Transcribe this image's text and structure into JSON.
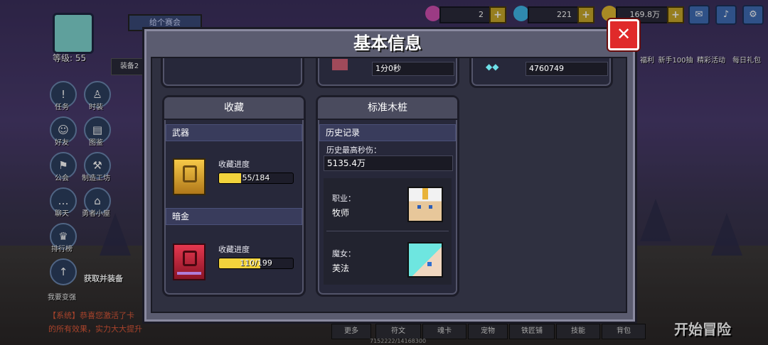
{
  "hud": {
    "level": "等级: 55",
    "name_placeholder": "给个赛会",
    "resources": [
      {
        "icon": "pink-gem-icon",
        "value": "2",
        "color": "#d14fb0"
      },
      {
        "icon": "blue-diamond-icon",
        "value": "221",
        "color": "#3fb7e8"
      },
      {
        "icon": "gold-coin-icon",
        "value": "169.8万",
        "color": "#e0b830"
      }
    ],
    "buttons": [
      "mail-icon",
      "sound-icon",
      "settings-icon"
    ]
  },
  "side_menu": [
    {
      "label": "任务",
      "icon": "task-icon"
    },
    {
      "label": "时装",
      "icon": "costume-icon"
    },
    {
      "label": "好友",
      "icon": "friends-icon"
    },
    {
      "label": "图鉴",
      "icon": "encyclopedia-icon"
    },
    {
      "label": "公会",
      "icon": "guild-icon"
    },
    {
      "label": "制造工坊",
      "icon": "workshop-icon"
    },
    {
      "label": "聊天",
      "icon": "chat-icon"
    },
    {
      "label": "勇者小屋",
      "icon": "hero-house-icon"
    },
    {
      "label": "排行榜",
      "icon": "ranking-icon"
    },
    {
      "label": "我要变强",
      "icon": "power-up-icon"
    }
  ],
  "right_menu": [
    {
      "label": "福利"
    },
    {
      "label": "新手100抽"
    },
    {
      "label": "精彩活动"
    },
    {
      "label": "每日礼包"
    }
  ],
  "bottom_tabs": [
    "更多",
    "符文",
    "魂卡",
    "宠物",
    "铁匠铺",
    "技能",
    "背包"
  ],
  "bottom_text": {
    "system_line1": "【系统】恭喜您激活了卡",
    "system_line2": "的所有效果，实力大大提升",
    "exp": "7152222/14168300",
    "start": "开始冒险",
    "equip_label": "装备2",
    "get_equip": "获取并装备"
  },
  "modal": {
    "title": "基本信息",
    "top_row": {
      "middle_value": "1分0秒",
      "right_value": "4760749"
    },
    "collection": {
      "title": "收藏",
      "weapon": {
        "section": "武器",
        "progress_label": "收藏进度",
        "progress_text": "55/184",
        "progress_fraction": 0.299
      },
      "dark_gold": {
        "section": "暗金",
        "progress_label": "收藏进度",
        "progress_text": "110/199",
        "progress_fraction": 0.553
      }
    },
    "dummy": {
      "title": "标准木桩",
      "history": "历史记录",
      "max_dps_label": "历史最高秒伤：",
      "max_dps_value": "5135.4万",
      "class_label": "职业：",
      "class_value": "牧师",
      "witch_label": "魔女：",
      "witch_value": "芙法"
    }
  }
}
